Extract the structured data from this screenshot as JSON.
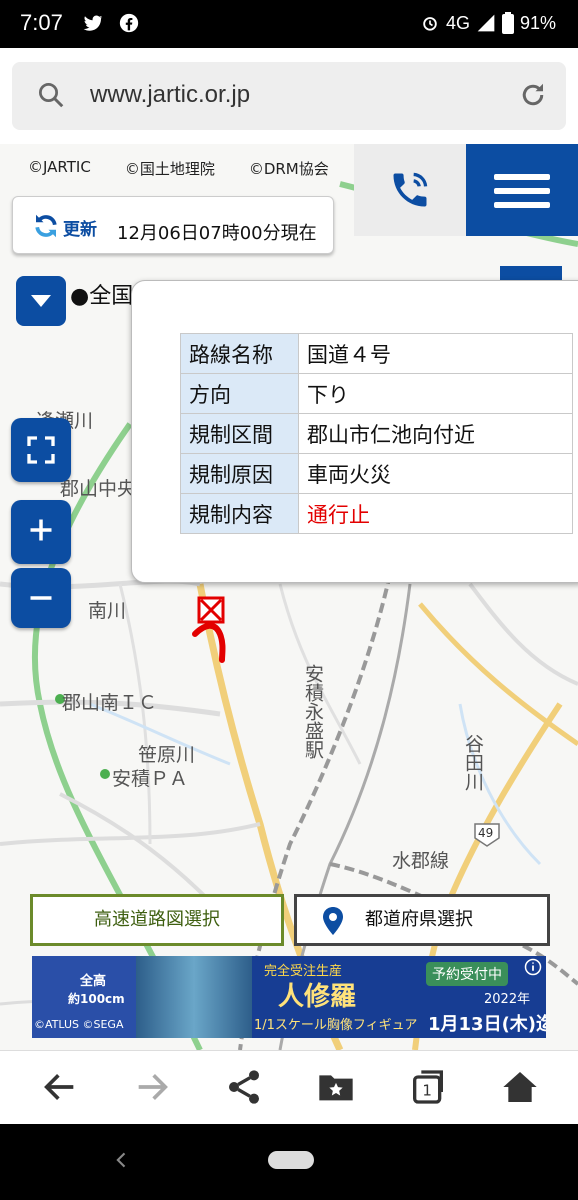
{
  "status": {
    "time": "7:07",
    "network": "4G",
    "battery": "91%"
  },
  "browser": {
    "url": "www.jartic.or.jp"
  },
  "map": {
    "credits": [
      "©JARTIC",
      "©国土地理院",
      "©DRM協会"
    ],
    "refresh_label": "更新",
    "updated_time": "12月06日07時00分現在",
    "ticker": "●全国",
    "labels": [
      "南川",
      "郡山南ＩＣ",
      "笹原川",
      "安積ＰＡ",
      "安積永盛駅",
      "谷田川",
      "水郡線",
      "郡山中央",
      "逢瀬川",
      "49"
    ]
  },
  "popup": {
    "rows": [
      {
        "key": "路線名称",
        "value": "国道４号"
      },
      {
        "key": "方向",
        "value": "下り"
      },
      {
        "key": "規制区間",
        "value": "郡山市仁池向付近"
      },
      {
        "key": "規制原因",
        "value": "車両火災"
      },
      {
        "key": "規制内容",
        "value": "通行止"
      }
    ]
  },
  "buttons": {
    "highway": "高速道路図選択",
    "prefecture": "都道府県選択"
  },
  "ad": {
    "brand_top": "全高",
    "size": "約100cm",
    "copyright": "©ATLUS ©SEGA",
    "series": "完全受注生産",
    "title": "人修羅",
    "subtitle": "1/1スケール胸像フィギュア",
    "preorder": "予約受付中",
    "year": "2022年",
    "deadline": "1月13日(木)迄"
  },
  "colors": {
    "primary": "#0c4da2",
    "alert": "#e30000",
    "highway_border": "#6b8a2a"
  }
}
